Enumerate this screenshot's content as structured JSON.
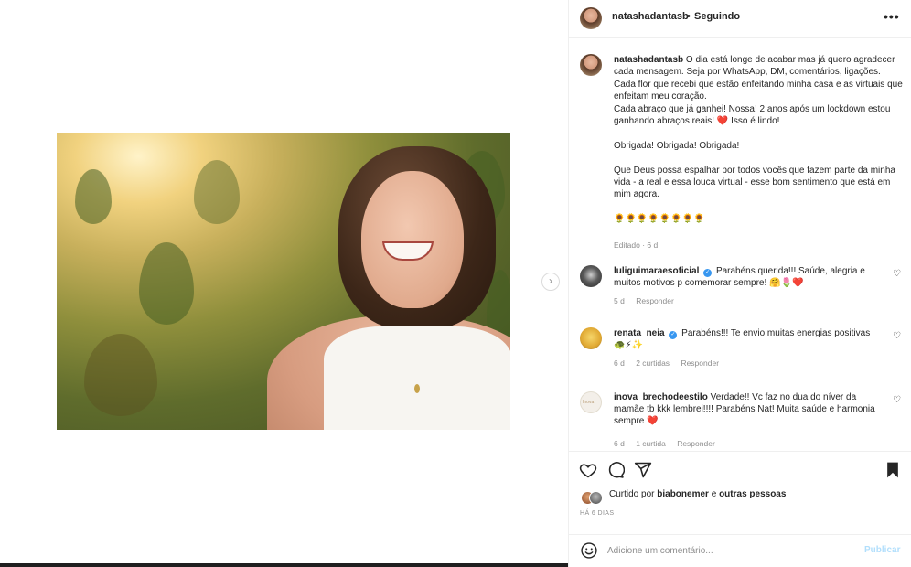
{
  "header": {
    "username": "natashadantasb",
    "separator": "•",
    "follow_status": "Seguindo",
    "more_icon": "more-horizontal-icon"
  },
  "caption": {
    "username": "natashadantasb",
    "text": " O dia está longe de acabar mas já quero agradecer cada mensagem. Seja por WhatsApp, DM, comentários, ligações. Cada flor que recebi que estão enfeitando minha casa e as virtuais que enfeitam meu coração.\nCada abraço que já ganhei! Nossa! 2 anos após um lockdown estou ganhando abraços reais! ❤️ Isso é lindo!\n\nObrigada! Obrigada! Obrigada!\n\nQue Deus possa espalhar por todos vocês que fazem parte da minha vida - a real e essa louca virtual - esse bom sentimento que está em mim agora.\n\n🌻🌻🌻🌻🌻🌻🌻🌻",
    "meta": "Editado · 6 d"
  },
  "comments": [
    {
      "username": "luliguimaraesoficial",
      "verified": true,
      "text": "Parabéns querida!!! Saúde, alegria e muitos motivos p comemorar sempre! 🤗🌷❤️",
      "time": "5 d",
      "likes": "",
      "reply": "Responder"
    },
    {
      "username": "renata_neia",
      "verified": true,
      "text": "Parabéns!!! Te envio muitas energias positivas 🐢⚡✨",
      "time": "6 d",
      "likes": "2 curtidas",
      "reply": "Responder"
    },
    {
      "username": "inova_brechodeestilo",
      "verified": false,
      "text": "Verdade!! Vc faz no dua do níver da mamãe tb kkk lembrei!!!! Parabéns Nat! Muita saúde e harmonia sempre ❤️",
      "time": "6 d",
      "likes": "1 curtida",
      "reply": "Responder",
      "avatar_text": "Inova"
    }
  ],
  "actions": {
    "liked_prefix": "Curtido por ",
    "liked_user": "biabonemer",
    "liked_and": " e ",
    "liked_others": "outras pessoas",
    "time_ago": "HÁ 6 DIAS"
  },
  "add_comment": {
    "placeholder": "Adicione um comentário...",
    "post_label": "Publicar"
  },
  "colors": {
    "link_blue_disabled": "#b2dffc",
    "verified_blue": "#3897f0",
    "heart_red": "#ed2c43",
    "muted_text": "#8e8e8e"
  }
}
